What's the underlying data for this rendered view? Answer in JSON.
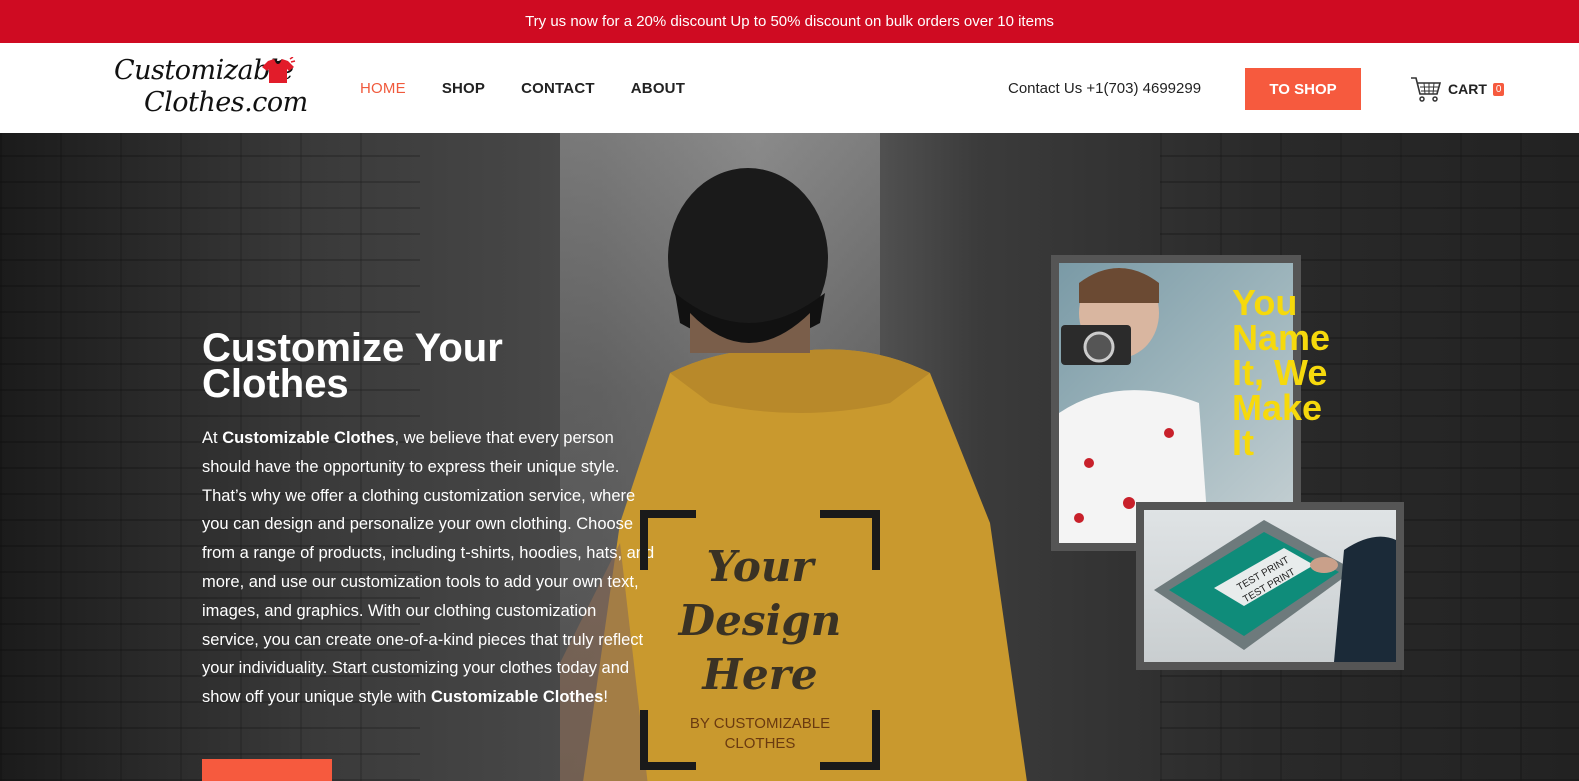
{
  "topbar": {
    "text": "Try us now for a 20% discount Up to 50% discount on bulk orders over 10 items"
  },
  "logo": {
    "line1": "Customizable",
    "line2": "Clothes.com"
  },
  "nav": {
    "items": [
      {
        "label": "HOME"
      },
      {
        "label": "SHOP"
      },
      {
        "label": "CONTACT"
      },
      {
        "label": "ABOUT"
      }
    ],
    "contact": "Contact Us +1(703) 4699299",
    "to_shop": "TO SHOP",
    "cart_label": "CART",
    "cart_count": "0"
  },
  "hero": {
    "headline": "Customize Your Clothes",
    "para_pre": "At ",
    "brand": "Customizable Clothes",
    "para_mid": ", we believe that every person should have the opportunity to express their unique style. That’s why we offer a clothing customization service, where you can design and personalize your own clothing. Choose from a range of products, including t-shirts, hoodies, hats, and more, and use our customization tools to add your own text, images, and graphics. With our clothing customization service, you can create one-of-a-kind pieces that truly reflect your individuality. Start customizing your clothes today and show off your unique style with ",
    "para_end": "!",
    "shirt_line1": "Your",
    "shirt_line2": "Design",
    "shirt_line3": "Here",
    "shirt_sub1": "BY CUSTOMIZABLE",
    "shirt_sub2": "CLOTHES",
    "slogan_1": "You",
    "slogan_2": "Name",
    "slogan_3": "It, We",
    "slogan_4": "Make",
    "slogan_5": "It",
    "print_text_1": "TEST PRINT",
    "print_text_2": "TEST PRINT"
  },
  "colors": {
    "accent": "#f65a3e",
    "topbar": "#cf0b22",
    "slogan": "#f6d90c"
  }
}
